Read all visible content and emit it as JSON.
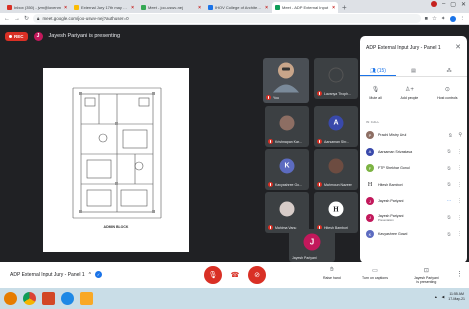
{
  "browser": {
    "tabs": [
      {
        "label": "Inbox (350) - jvm@lovenm",
        "active": false,
        "color": "#d93025"
      },
      {
        "label": "External Jury 17th may 2021",
        "active": false,
        "color": "#fbbc04"
      },
      {
        "label": "Meet - joo-uswv-nej",
        "active": false,
        "color": "#34a853"
      },
      {
        "label": "IHOV College of Architecture",
        "active": false,
        "color": "#1a73e8"
      },
      {
        "label": "Meet - ADP External Input",
        "active": true,
        "color": "#0f9d58"
      }
    ],
    "new_tab": "+",
    "url": "meet.google.com/joo-uswv-nej?authuser=0"
  },
  "meeting": {
    "rec_label": "REC",
    "presenter_initial": "J",
    "presenting_text": "Jayesh Pariyani is presenting"
  },
  "presentation": {
    "plan_label": "ADMIN BLOCK"
  },
  "tiles": [
    {
      "name": "You",
      "initial": "",
      "color": "#5f6368",
      "photo": true
    },
    {
      "name": "Lavanya Thoph...",
      "initial": "",
      "color": "#3c4043",
      "photo": true
    },
    {
      "name": "Krishnapan Kar...",
      "initial": "",
      "color": "#8d6e63",
      "photo": true
    },
    {
      "name": "Aarsaman Shr...",
      "initial": "A",
      "color": "#3949ab",
      "photo": false
    },
    {
      "name": "Kavyashree Go...",
      "initial": "K",
      "color": "#5c6bc0",
      "photo": false
    },
    {
      "name": "Mahmoun Nazeer",
      "initial": "",
      "color": "#6d4c41",
      "photo": true
    },
    {
      "name": "Mahima Vanu",
      "initial": "",
      "color": "#a1887f",
      "photo": true
    },
    {
      "name": "Hitesh Bambori",
      "initial": "H",
      "color": "#ffffff",
      "photo": false
    },
    {
      "name": "Jayesh Pariyani",
      "initial": "J",
      "color": "#c2185b",
      "photo": false
    }
  ],
  "panel": {
    "title": "ADP External Input Jury - Panel 1",
    "close": "✕",
    "tabs": [
      {
        "label": "(15)",
        "icon": "people-icon"
      },
      {
        "label": "",
        "icon": "chat-icon"
      },
      {
        "label": "",
        "icon": "activities-icon"
      }
    ],
    "actions": [
      {
        "label": "Mute all",
        "icon": "mic-off-icon"
      },
      {
        "label": "Add people",
        "icon": "add-person-icon"
      },
      {
        "label": "Host controls",
        "icon": "toggle-icon"
      }
    ],
    "section_label": "IN CALL",
    "participants": [
      {
        "name": "Prachi Mistry Urul",
        "sub": "",
        "initial": "P",
        "color": "#8d6e63"
      },
      {
        "name": "Aarsaman Srivastava",
        "sub": "",
        "initial": "A",
        "color": "#3949ab"
      },
      {
        "name": "FTP Shekhar Gonul",
        "sub": "",
        "initial": "F",
        "color": "#7cb342"
      },
      {
        "name": "Hitesh Bambori",
        "sub": "",
        "initial": "H",
        "color": "#ffffff"
      },
      {
        "name": "Jayesh Pariyani",
        "sub": "",
        "initial": "J",
        "color": "#c2185b"
      },
      {
        "name": "Jayesh Pariyani",
        "sub": "Presentation",
        "initial": "J",
        "color": "#c2185b"
      },
      {
        "name": "Kavyashree Gowd",
        "sub": "",
        "initial": "K",
        "color": "#5c6bc0"
      }
    ]
  },
  "toolbar": {
    "meeting_name": "ADP External Input Jury - Panel 1",
    "caret": "^",
    "raise_hand": "Raise hand",
    "captions": "Turn on captions",
    "presenting": "Jayesh Pariyani\nis presenting"
  },
  "taskbar": {
    "time": "11:55 AM",
    "date": "17-May-21"
  }
}
